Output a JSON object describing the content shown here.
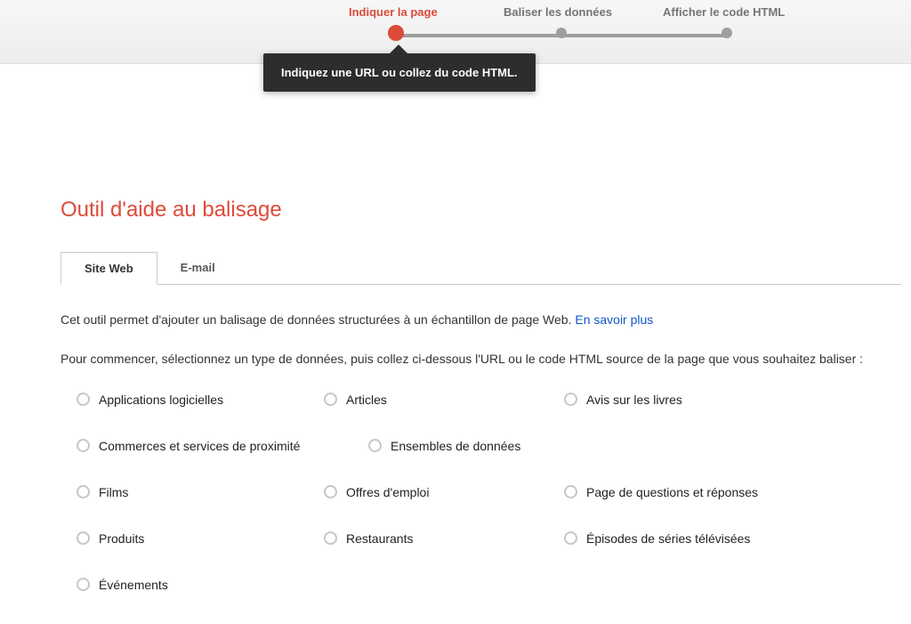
{
  "stepper": {
    "steps": [
      {
        "label": "Indiquer la page",
        "active": true
      },
      {
        "label": "Baliser les données",
        "active": false
      },
      {
        "label": "Afficher le code HTML",
        "active": false
      }
    ],
    "tooltip": "Indiquez une URL ou collez du code HTML."
  },
  "page": {
    "title": "Outil d'aide au balisage"
  },
  "tabs": {
    "active": "Site Web",
    "items": [
      "Site Web",
      "E-mail"
    ]
  },
  "intro": {
    "line1_prefix": "Cet outil permet d'ajouter un balisage de données structurées à un échantillon de page Web. ",
    "learn_more": "En savoir plus",
    "line2": "Pour commencer, sélectionnez un type de données, puis collez ci-dessous l'URL ou le code HTML source de la page que vous souhaitez baliser :"
  },
  "data_types": {
    "rows": [
      [
        "Applications logicielles",
        "Articles",
        "Avis sur les livres"
      ],
      [
        "Commerces et services de proximité",
        "Ensembles de données"
      ],
      [
        "Films",
        "Offres d'emploi",
        "Page de questions et réponses"
      ],
      [
        "Produits",
        "Restaurants",
        "Épisodes de séries télévisées"
      ],
      [
        "Événements"
      ]
    ]
  }
}
